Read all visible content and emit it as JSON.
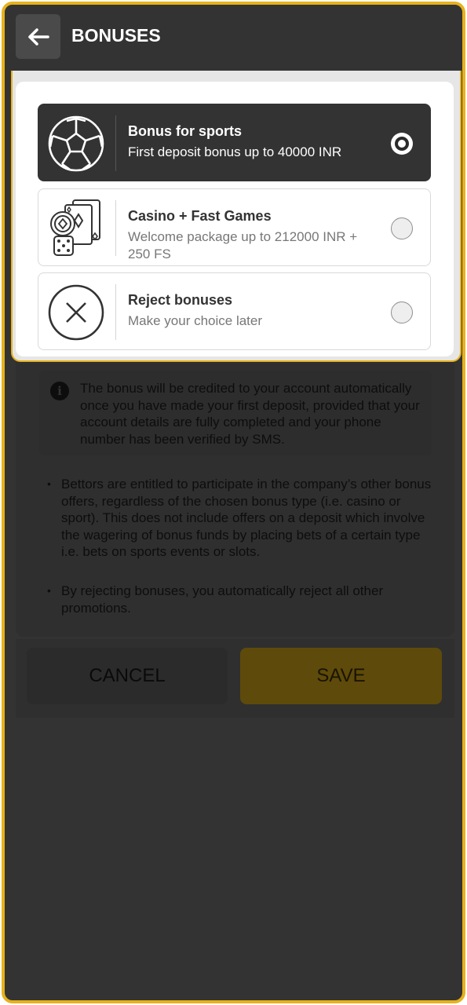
{
  "header": {
    "title": "BONUSES",
    "back_icon": "arrow-left-icon"
  },
  "options": [
    {
      "title": "Bonus for sports",
      "subtitle": "First deposit bonus up to 40000 INR",
      "icon": "soccer-ball-icon",
      "selected": true
    },
    {
      "title": "Casino + Fast Games",
      "subtitle": "Welcome package up to 212000 INR + 250 FS",
      "icon": "cards-chip-dice-icon",
      "selected": false
    },
    {
      "title": "Reject bonuses",
      "subtitle": "Make your choice later",
      "icon": "circle-x-icon",
      "selected": false
    }
  ],
  "info": {
    "icon": "info-icon",
    "text": "The bonus will be credited to your account automatically once you have made your first deposit, provided that your account details are fully completed and your phone number has been verified by SMS."
  },
  "bullets": [
    "Bettors are entitled to participate in the company’s other bonus offers, regardless of the chosen bonus type (i.e. casino or sport). This does not include offers on a deposit which involve the wagering of bonus funds by placing bets of a certain type i.e. bets on sports events or slots.",
    "By rejecting bonuses, you automatically reject all other promotions."
  ],
  "buttons": {
    "cancel": "CANCEL",
    "save": "SAVE"
  },
  "colors": {
    "accent": "#e6b21c",
    "background": "#333333",
    "selected_option": "#333333"
  }
}
